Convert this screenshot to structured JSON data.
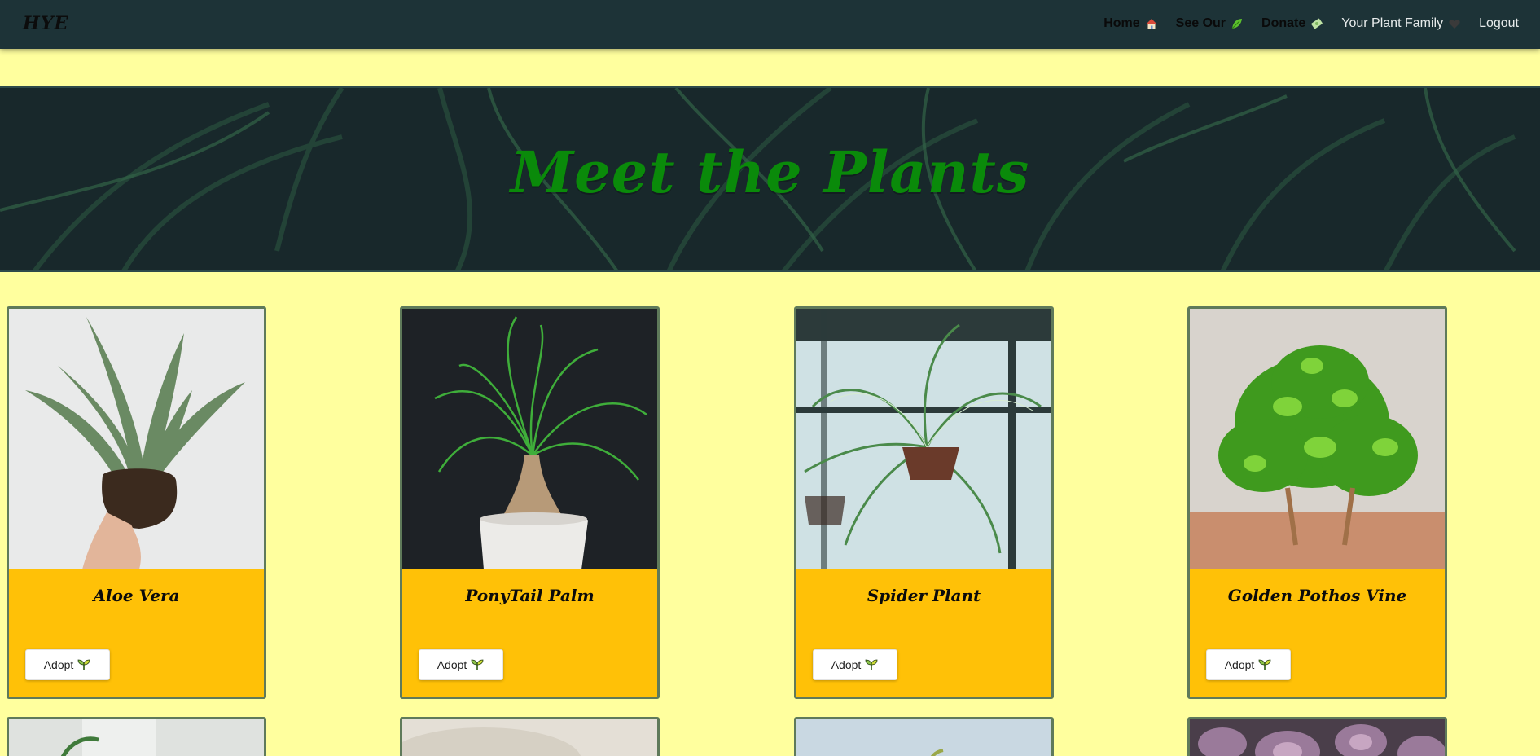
{
  "navbar": {
    "brand": "HYE",
    "links": [
      {
        "label": "Home",
        "icon": "house-icon"
      },
      {
        "label": "See Our",
        "icon": "leaf-icon"
      },
      {
        "label": "Donate",
        "icon": "money-icon"
      },
      {
        "label": "Your Plant Family",
        "icon": "heart-icon"
      },
      {
        "label": "Logout"
      }
    ]
  },
  "hero": {
    "title": "Meet the Plants"
  },
  "cards": [
    {
      "name": "Aloe Vera",
      "button": "Adopt",
      "icon": "sprout-icon"
    },
    {
      "name": "PonyTail Palm",
      "button": "Adopt",
      "icon": "sprout-icon"
    },
    {
      "name": "Spider Plant",
      "button": "Adopt",
      "icon": "sprout-icon"
    },
    {
      "name": "Golden Pothos Vine",
      "button": "Adopt",
      "icon": "sprout-icon"
    }
  ],
  "colors": {
    "page_background": "#ffff9e",
    "navbar": "#1d3337",
    "card_footer": "#ffc107",
    "hero_title": "#0a8a0a",
    "card_border": "#5f7a5a"
  }
}
